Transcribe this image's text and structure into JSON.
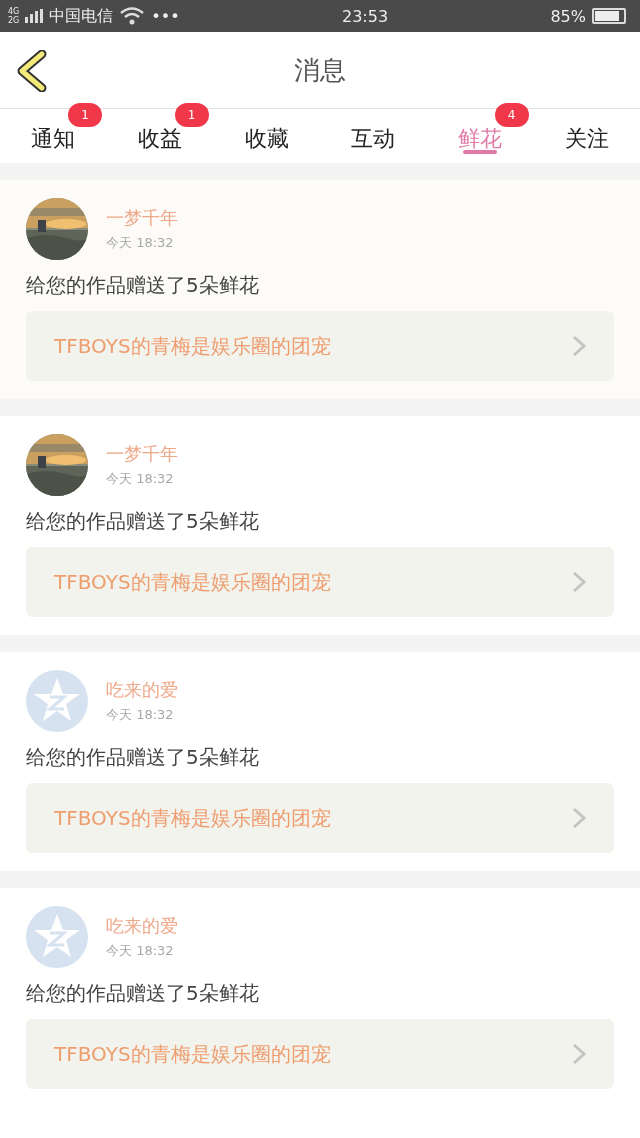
{
  "status_bar": {
    "network_top": "4G",
    "network_bottom": "2G",
    "carrier": "中国电信",
    "more": "•••",
    "time": "23:53",
    "battery_text": "85%"
  },
  "header": {
    "title": "消息"
  },
  "tabs": [
    {
      "label": "通知",
      "badge": "1",
      "selected": false
    },
    {
      "label": "收益",
      "badge": "1",
      "selected": false
    },
    {
      "label": "收藏",
      "selected": false
    },
    {
      "label": "互动",
      "selected": false
    },
    {
      "label": "鲜花",
      "badge": "4",
      "selected": true
    },
    {
      "label": "关注",
      "selected": false
    }
  ],
  "messages": [
    {
      "name": "一梦千年",
      "time": "今天 18:32",
      "text": "给您的作品赠送了5朵鲜花",
      "link": "TFBOYS的青梅是娱乐圈的团宠"
    },
    {
      "name": "一梦千年",
      "time": "今天 18:32",
      "text": "给您的作品赠送了5朵鲜花",
      "link": "TFBOYS的青梅是娱乐圈的团宠"
    },
    {
      "avatar": {
        "kind": "default"
      },
      "name": "吃来的爱",
      "time": "今天 18:32",
      "text": "给您的作品赠送了5朵鲜花",
      "link": "TFBOYS的青梅是娱乐圈的团宠"
    },
    {
      "avatar": {
        "kind": "default"
      },
      "name": "吃来的爱",
      "time": "今天 18:32",
      "text": "给您的作品赠送了5朵鲜花",
      "link": "TFBOYS的青梅是娱乐圈的团宠"
    }
  ]
}
